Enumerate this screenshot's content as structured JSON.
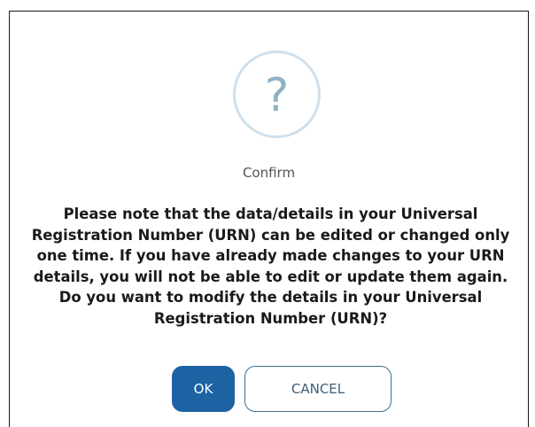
{
  "dialog": {
    "icon": "question-mark-icon",
    "icon_glyph": "?",
    "title": "Confirm",
    "message": "Please note that the data/details in your Universal Registration Number (URN) can be edited or changed only one time. If you have already made changes to your URN details, you will not be able to edit or update them again. Do you want to modify the details in your Universal Registration Number (URN)?",
    "ok_label": "OK",
    "cancel_label": "CANCEL"
  },
  "colors": {
    "ok_button": "#1d63a3",
    "icon_ring": "#cfe0ec",
    "icon_glyph": "#8fb1c6",
    "cancel_border": "#3d6f94"
  }
}
